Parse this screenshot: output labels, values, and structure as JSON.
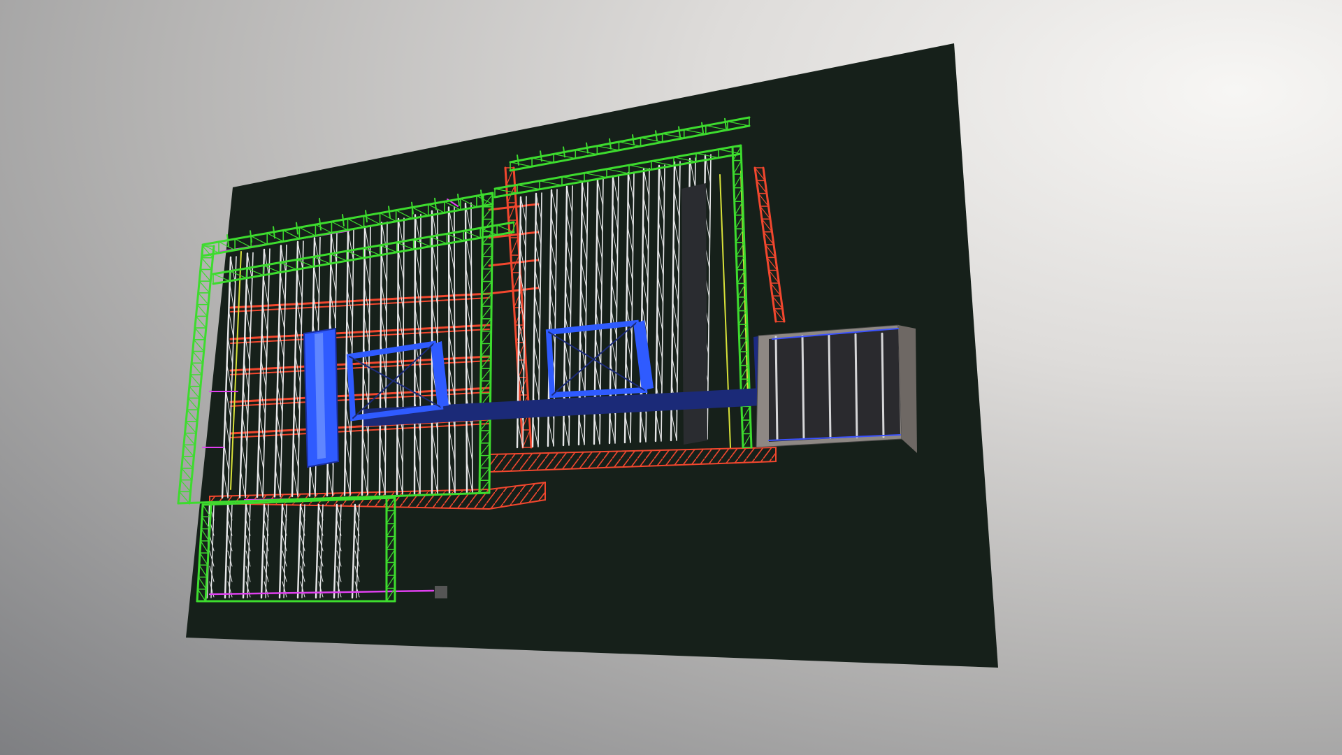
{
  "viewer": {
    "background_colors": [
      "#f7f6f4",
      "#dedcda",
      "#b4b3b2",
      "#7e7f82"
    ],
    "model": {
      "ground_color": "#16201a",
      "colors": {
        "outer_truss": "#3ddc2e",
        "inner_truss": "#e8e8ea",
        "red_truss": "#f2472e",
        "yellow_truss": "#d8e23a",
        "magenta_line": "#e040f0",
        "blue_frame": "#2f5bff",
        "dark_beam": "#1b2a78",
        "dark_box": "#2a2a2e",
        "box_side": "#8e8884"
      }
    }
  }
}
